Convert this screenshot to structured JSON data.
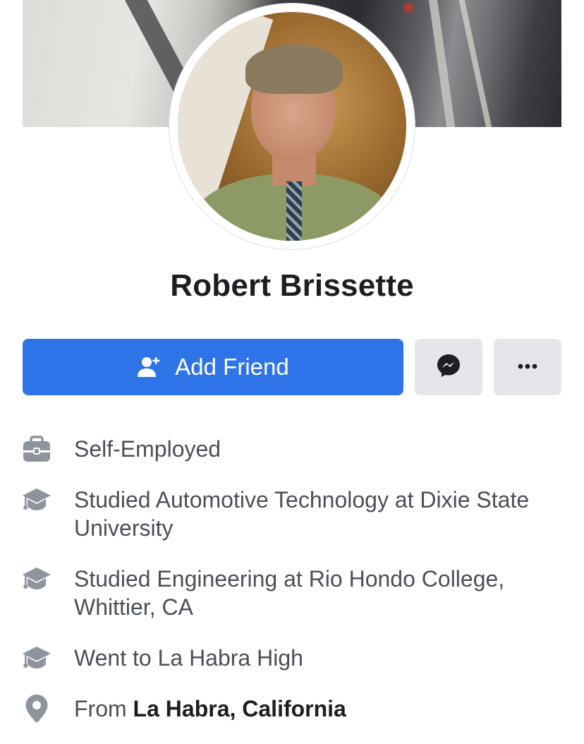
{
  "profile": {
    "name": "Robert Brissette"
  },
  "actions": {
    "add_friend_label": "Add Friend"
  },
  "info": {
    "work": "Self-Employed",
    "education": [
      "Studied Automotive Technology at Dixie State University",
      "Studied Engineering at Rio Hondo College, Whittier, CA",
      "Went to La Habra High"
    ],
    "from_prefix": "From",
    "from_place": "La Habra, California"
  },
  "icons": {
    "add_friend": "add-friend-icon",
    "messenger": "messenger-icon",
    "more": "more-icon",
    "work": "briefcase-icon",
    "education": "graduation-cap-icon",
    "location": "location-pin-icon"
  },
  "colors": {
    "primary": "#2e74e8",
    "secondary_button": "#e4e6eb",
    "icon_gray": "#8d949e",
    "text_primary": "#1c1e21",
    "text_secondary": "#4b4f56"
  }
}
